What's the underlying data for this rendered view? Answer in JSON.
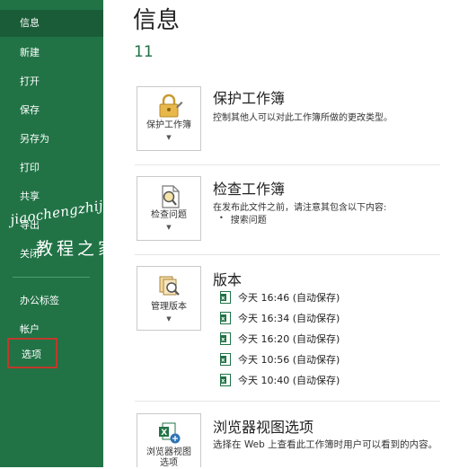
{
  "sidebar": {
    "items": [
      {
        "label": "信息"
      },
      {
        "label": "新建"
      },
      {
        "label": "打开"
      },
      {
        "label": "保存"
      },
      {
        "label": "另存为"
      },
      {
        "label": "打印"
      },
      {
        "label": "共享"
      },
      {
        "label": "导出"
      },
      {
        "label": "关闭"
      },
      {
        "label": "办公标签"
      },
      {
        "label": "帐户"
      },
      {
        "label": "选项"
      }
    ]
  },
  "watermark": {
    "latin": "jiaochengzhijia",
    "chinese": "教程之家"
  },
  "main": {
    "title": "信息",
    "document_name": "11",
    "protect": {
      "tile_label": "保护工作簿",
      "title": "保护工作簿",
      "description": "控制其他人可以对此工作簿所做的更改类型。"
    },
    "inspect": {
      "tile_label": "检查问题",
      "title": "检查工作簿",
      "description": "在发布此文件之前，请注意其包含以下内容:",
      "bullet": "搜索问题"
    },
    "versions": {
      "tile_label": "管理版本",
      "title": "版本",
      "items": [
        {
          "text": "今天 16:46 (自动保存)"
        },
        {
          "text": "今天 16:34 (自动保存)"
        },
        {
          "text": "今天 16:20 (自动保存)"
        },
        {
          "text": "今天 10:56 (自动保存)"
        },
        {
          "text": "今天 10:40 (自动保存)"
        }
      ]
    },
    "browser": {
      "tile_label_1": "浏览器视图",
      "tile_label_2": "选项",
      "title": "浏览器视图选项",
      "description": "选择在 Web 上查看此工作簿时用户可以看到的内容。"
    }
  },
  "colors": {
    "sidebar_bg": "#217346",
    "sidebar_active": "#1a5c38",
    "selection_border": "#c0392b",
    "doc_name": "#1e7145"
  }
}
